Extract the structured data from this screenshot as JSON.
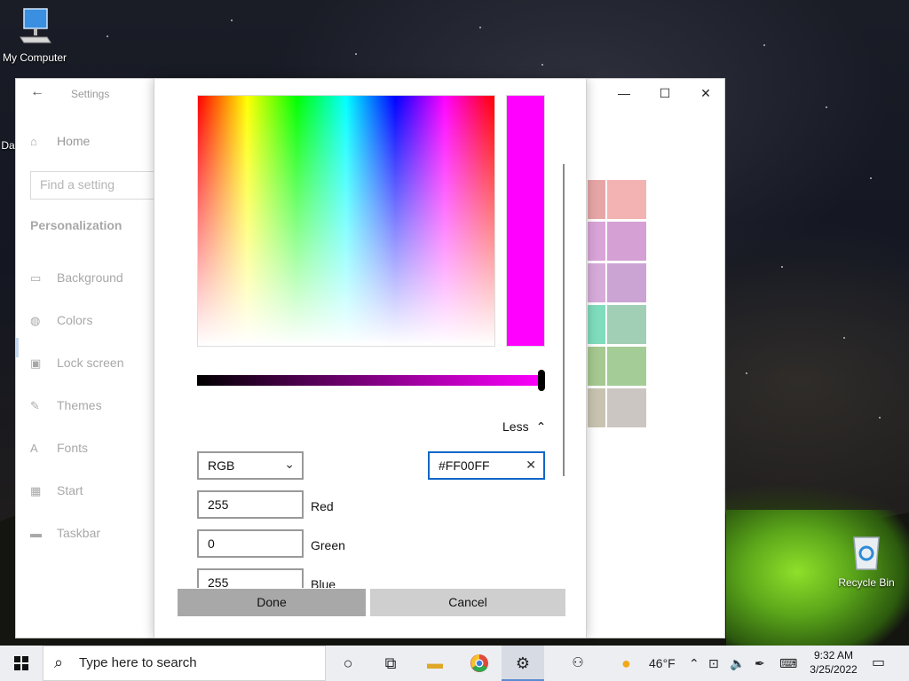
{
  "desktop": {
    "icons": [
      {
        "label": "My Computer"
      },
      {
        "label": "Da"
      },
      {
        "label": "Recycle Bin"
      }
    ]
  },
  "settings": {
    "title": "Settings",
    "nav": {
      "home": "Home",
      "search_placeholder": "Find a setting",
      "section": "Personalization",
      "items": [
        "Background",
        "Colors",
        "Lock screen",
        "Themes",
        "Fonts",
        "Start",
        "Taskbar"
      ],
      "selected": "Colors"
    },
    "swatch_colors": [
      "#e7a6a6",
      "#f3b3b3",
      "#d9a4d8",
      "#d5a0d3",
      "#d7abd9",
      "#cba4d4",
      "#7fdcbd",
      "#a1cfb5",
      "#a5c990",
      "#a4cc97",
      "#c8c3b0",
      "#ccc6c3"
    ]
  },
  "dialog": {
    "selected_color": "#FF00FF",
    "less_label": "Less",
    "mode_select": "RGB",
    "hex_value": "#FF00FF",
    "red_value": "255",
    "red_label": "Red",
    "green_value": "0",
    "green_label": "Green",
    "blue_value": "255",
    "blue_label": "Blue",
    "done_label": "Done",
    "cancel_label": "Cancel"
  },
  "taskbar": {
    "search_placeholder": "Type here to search",
    "weather": "46°F",
    "time": "9:32 AM",
    "date": "3/25/2022"
  }
}
